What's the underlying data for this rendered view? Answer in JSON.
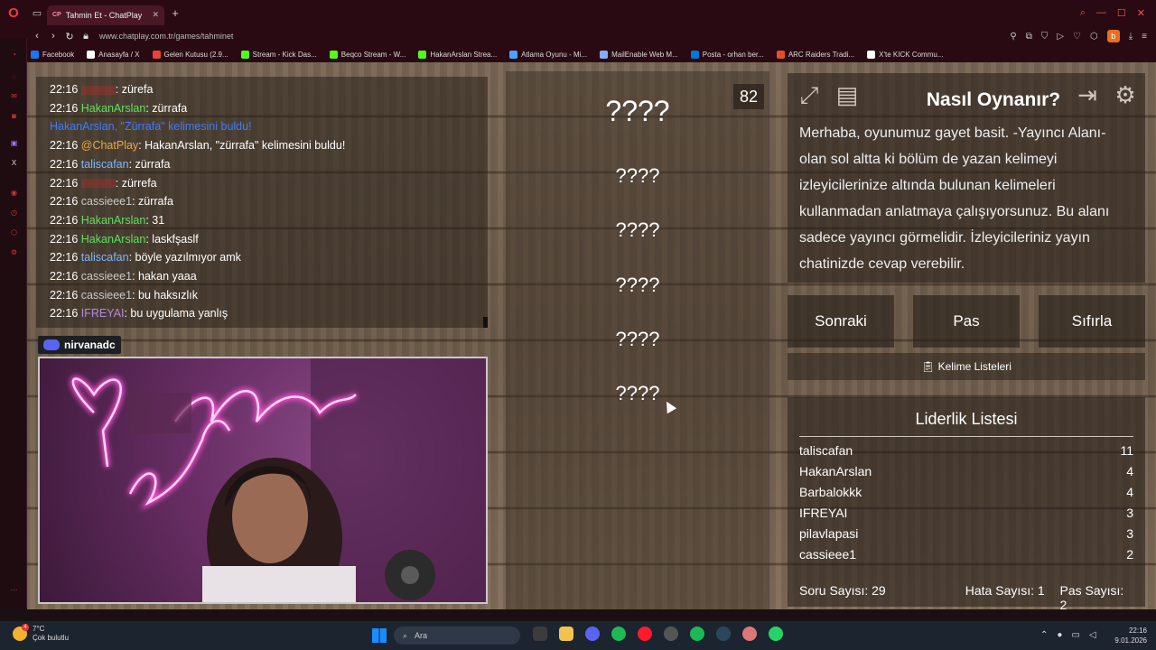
{
  "browser": {
    "tab_title": "Tahmin Et - ChatPlay",
    "tab_favicon": "CP",
    "url": "www.chatplay.com.tr/games/tahminet",
    "ext_badge": "b",
    "bookmarks": [
      {
        "label": "Facebook",
        "icon": "facebook-icon",
        "color": "#1877f2"
      },
      {
        "label": "Anasayfa / X",
        "icon": "x-icon",
        "color": "#ffffff"
      },
      {
        "label": "Gelen Kutusu (2.9...",
        "icon": "gmail-icon",
        "color": "#ea4335"
      },
      {
        "label": "Stream - Kick Das...",
        "icon": "kick-icon",
        "color": "#53fc18"
      },
      {
        "label": "Beqco Stream - W...",
        "icon": "kick-icon",
        "color": "#53fc18"
      },
      {
        "label": "HakanArslan Strea...",
        "icon": "kick-icon",
        "color": "#53fc18"
      },
      {
        "label": "Atlama Oyunu - Mi...",
        "icon": "game-icon",
        "color": "#4aa3ff"
      },
      {
        "label": "MailEnable Web M...",
        "icon": "mail-icon",
        "color": "#88aaff"
      },
      {
        "label": "Posta - orhan ber...",
        "icon": "outlook-icon",
        "color": "#0078d4"
      },
      {
        "label": "ARC Raiders Tradi...",
        "icon": "arc-icon",
        "color": "#e0502a"
      },
      {
        "label": "X'te KICK Commu...",
        "icon": "x-icon",
        "color": "#ffffff"
      }
    ]
  },
  "chat": {
    "messages": [
      {
        "time": "22:16",
        "user": "",
        "color": "red",
        "text": ": zürefa"
      },
      {
        "time": "22:16",
        "user": "HakanArslan",
        "color": "green",
        "text": ": zürrafa"
      },
      {
        "time": "",
        "user": "",
        "color": "sys",
        "text": "HakanArslan, \"Zürrafa\" kelimesini buldu!"
      },
      {
        "time": "22:16",
        "user": "@ChatPlay",
        "color": "gold",
        "text": ": HakanArslan, \"zürrafa\" kelimesini buldu!"
      },
      {
        "time": "22:16",
        "user": "taliscafan",
        "color": "blue",
        "text": ": zürrafa"
      },
      {
        "time": "22:16",
        "user": "",
        "color": "red",
        "text": ": zürrefa"
      },
      {
        "time": "22:16",
        "user": "cassieee1",
        "color": "grey",
        "text": ": zürrafa"
      },
      {
        "time": "22:16",
        "user": "HakanArslan",
        "color": "green",
        "text": ": 31"
      },
      {
        "time": "22:16",
        "user": "HakanArslan",
        "color": "green",
        "text": ": laskfşaslf"
      },
      {
        "time": "22:16",
        "user": "taliscafan",
        "color": "blue",
        "text": ": böyle yazılmıyor amk"
      },
      {
        "time": "22:16",
        "user": "cassieee1",
        "color": "grey",
        "text": ": hakan yaaa"
      },
      {
        "time": "22:16",
        "user": "cassieee1",
        "color": "grey",
        "text": ": bu haksızlık"
      },
      {
        "time": "22:16",
        "user": "IFREYAI",
        "color": "lav",
        "text": ": bu uygulama yanlış"
      }
    ]
  },
  "discord": {
    "name": "nirvanadc"
  },
  "words": {
    "counter": "82",
    "main": "????",
    "hints": [
      "????",
      "????",
      "????",
      "????",
      "????"
    ]
  },
  "help": {
    "title": "Nasıl Oynanır?",
    "text": "Merhaba, oyunumuz gayet basit. -Yayıncı Alanı- olan sol altta ki bölüm de yazan kelimeyi izleyicilerinize altında bulunan kelimeleri kullanmadan anlatmaya çalışıyorsunuz. Bu alanı sadece yayıncı görmelidir. İzleyicileriniz yayın chatinizde cevap verebilir."
  },
  "buttons": {
    "next": "Sonraki",
    "pass": "Pas",
    "reset": "Sıfırla"
  },
  "word_lists": "Kelime Listeleri",
  "leaderboard": {
    "title": "Liderlik Listesi",
    "rows": [
      {
        "name": "taliscafan",
        "score": "11"
      },
      {
        "name": "HakanArslan",
        "score": "4"
      },
      {
        "name": "Barbalokkk",
        "score": "4"
      },
      {
        "name": "IFREYAI",
        "score": "3"
      },
      {
        "name": "pilavlapasi",
        "score": "3"
      },
      {
        "name": "cassieee1",
        "score": "2"
      }
    ],
    "stats": {
      "questions": "Soru Sayısı: 29",
      "errors": "Hata Sayısı: 1",
      "passes": "Pas Sayısı: 2"
    }
  },
  "taskbar": {
    "temp": "7°C",
    "weather": "Çok bulutlu",
    "badge": "4",
    "search": "Ara",
    "time": "22:16",
    "date": "9.01.2026"
  }
}
